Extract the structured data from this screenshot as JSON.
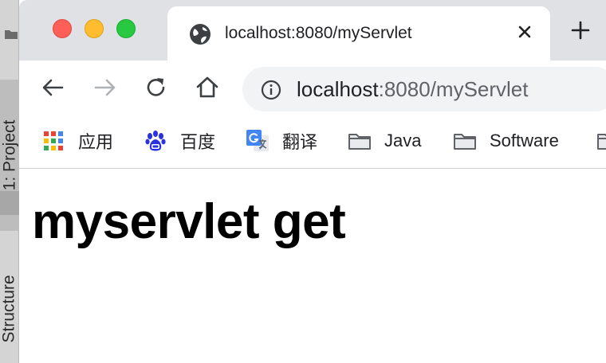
{
  "ide": {
    "project_tab": "1: Project",
    "structure_tab": "Structure"
  },
  "tab": {
    "title": "localhost:8080/myServlet",
    "favicon": "globe-icon"
  },
  "omnibox": {
    "host": "localhost",
    "rest": ":8080/myServlet"
  },
  "bookmarks": [
    {
      "label": "应用",
      "icon": "apps-grid-icon"
    },
    {
      "label": "百度",
      "icon": "baidu-icon"
    },
    {
      "label": "翻译",
      "icon": "google-translate-icon"
    },
    {
      "label": "Java",
      "icon": "folder-icon"
    },
    {
      "label": "Software",
      "icon": "folder-icon"
    }
  ],
  "page": {
    "heading": "myservlet get"
  },
  "colors": {
    "tabbar": "#dfe1e5",
    "omnibox": "#f1f3f4",
    "close": "#fe5f57",
    "minimize": "#febc2e",
    "zoom": "#28c840"
  }
}
